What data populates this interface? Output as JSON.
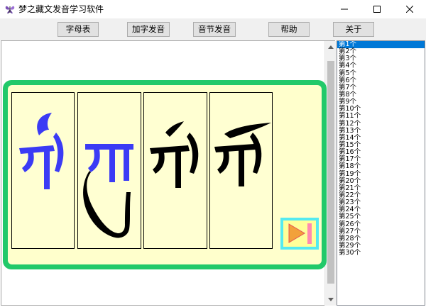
{
  "window": {
    "title": "梦之藏文发音学习软件",
    "icon": "butterfly-app-icon",
    "controls": [
      "minimize-icon",
      "maximize-icon",
      "close-icon"
    ]
  },
  "toolbar": {
    "alphabet_label": "字母表",
    "add_char_label": "加字发音",
    "syllable_label": "音节发音",
    "help_label": "帮助",
    "about_label": "关于"
  },
  "display": {
    "syllables": [
      {
        "glyph": "གི",
        "color": "#3b3bf5"
      },
      {
        "glyph": "གུ",
        "color": "#3b3bf5"
      },
      {
        "glyph": "གེ",
        "color": "#000000"
      },
      {
        "glyph": "གོ",
        "color": "#000000"
      }
    ],
    "frame_color": "#22c96a",
    "background_color": "#ffffcc",
    "play_icon": "play-icon"
  },
  "list": {
    "selected_index": 0,
    "items": [
      "第1个",
      "第2个",
      "第3个",
      "第4个",
      "第5个",
      "第6个",
      "第7个",
      "第8个",
      "第9个",
      "第10个",
      "第11个",
      "第12个",
      "第13个",
      "第14个",
      "第15个",
      "第16个",
      "第17个",
      "第18个",
      "第19个",
      "第20个",
      "第21个",
      "第22个",
      "第23个",
      "第24个",
      "第25个",
      "第26个",
      "第27个",
      "第28个",
      "第29个",
      "第30个"
    ]
  }
}
